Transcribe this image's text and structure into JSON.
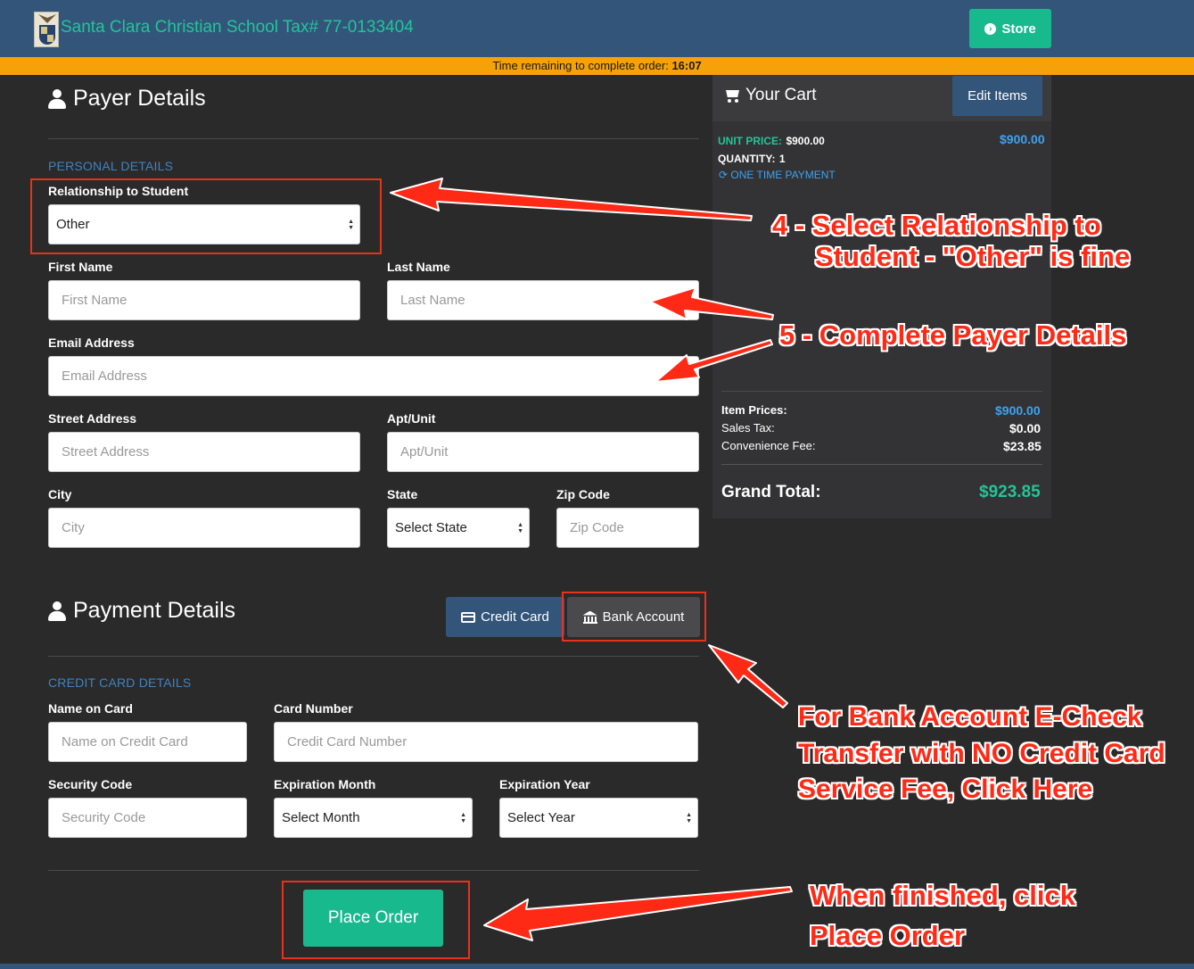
{
  "header": {
    "site_title": "Santa Clara Christian School Tax# 77-0133404",
    "store_label": "Store",
    "timer_prefix": "Time remaining to complete order:",
    "timer_value": "16:07"
  },
  "payer": {
    "heading": "Payer Details",
    "section_label": "PERSONAL DETAILS",
    "relationship_label": "Relationship to Student",
    "relationship_value": "Other",
    "first_name_label": "First Name",
    "first_name_placeholder": "First Name",
    "last_name_label": "Last Name",
    "last_name_placeholder": "Last Name",
    "email_label": "Email Address",
    "email_placeholder": "Email Address",
    "street_label": "Street Address",
    "street_placeholder": "Street Address",
    "apt_label": "Apt/Unit",
    "apt_placeholder": "Apt/Unit",
    "city_label": "City",
    "city_placeholder": "City",
    "state_label": "State",
    "state_value": "Select State",
    "zip_label": "Zip Code",
    "zip_placeholder": "Zip Code"
  },
  "payment": {
    "heading": "Payment Details",
    "tab_credit": "Credit Card",
    "tab_bank": "Bank Account",
    "section_label": "CREDIT CARD DETAILS",
    "name_label": "Name on Card",
    "name_placeholder": "Name on Credit Card",
    "card_label": "Card Number",
    "card_placeholder": "Credit Card Number",
    "cvc_label": "Security Code",
    "cvc_placeholder": "Security Code",
    "month_label": "Expiration Month",
    "month_value": "Select Month",
    "year_label": "Expiration Year",
    "year_value": "Select Year",
    "place_order": "Place Order"
  },
  "cart": {
    "title": "Your Cart",
    "edit_label": "Edit Items",
    "unit_price_label": "UNIT PRICE:",
    "unit_price_value": "$900.00",
    "line_total": "$900.00",
    "quantity_label": "QUANTITY:",
    "quantity_value": "1",
    "payment_type": "ONE TIME PAYMENT",
    "item_prices_label": "Item Prices:",
    "item_prices_value": "$900.00",
    "sales_tax_label": "Sales Tax:",
    "sales_tax_value": "$0.00",
    "fee_label": "Convenience Fee:",
    "fee_value": "$23.85",
    "grand_total_label": "Grand Total:",
    "grand_total_value": "$923.85"
  },
  "annotations": {
    "step4_line1": "4 - Select Relationship to",
    "step4_line2": "Student - \"Other\" is fine",
    "step5": "5 - Complete Payer Details",
    "bank_line1": "For Bank Account E-Check",
    "bank_line2": "Transfer with NO Credit Card",
    "bank_line3": "Service Fee, Click Here",
    "finish_line1": "When finished, click",
    "finish_line2": "Place Order"
  },
  "colors": {
    "header_blue": "#33557a",
    "accent_green": "#19b98e",
    "timer_orange": "#f5a20a",
    "annotation_red": "#ff2a16"
  }
}
